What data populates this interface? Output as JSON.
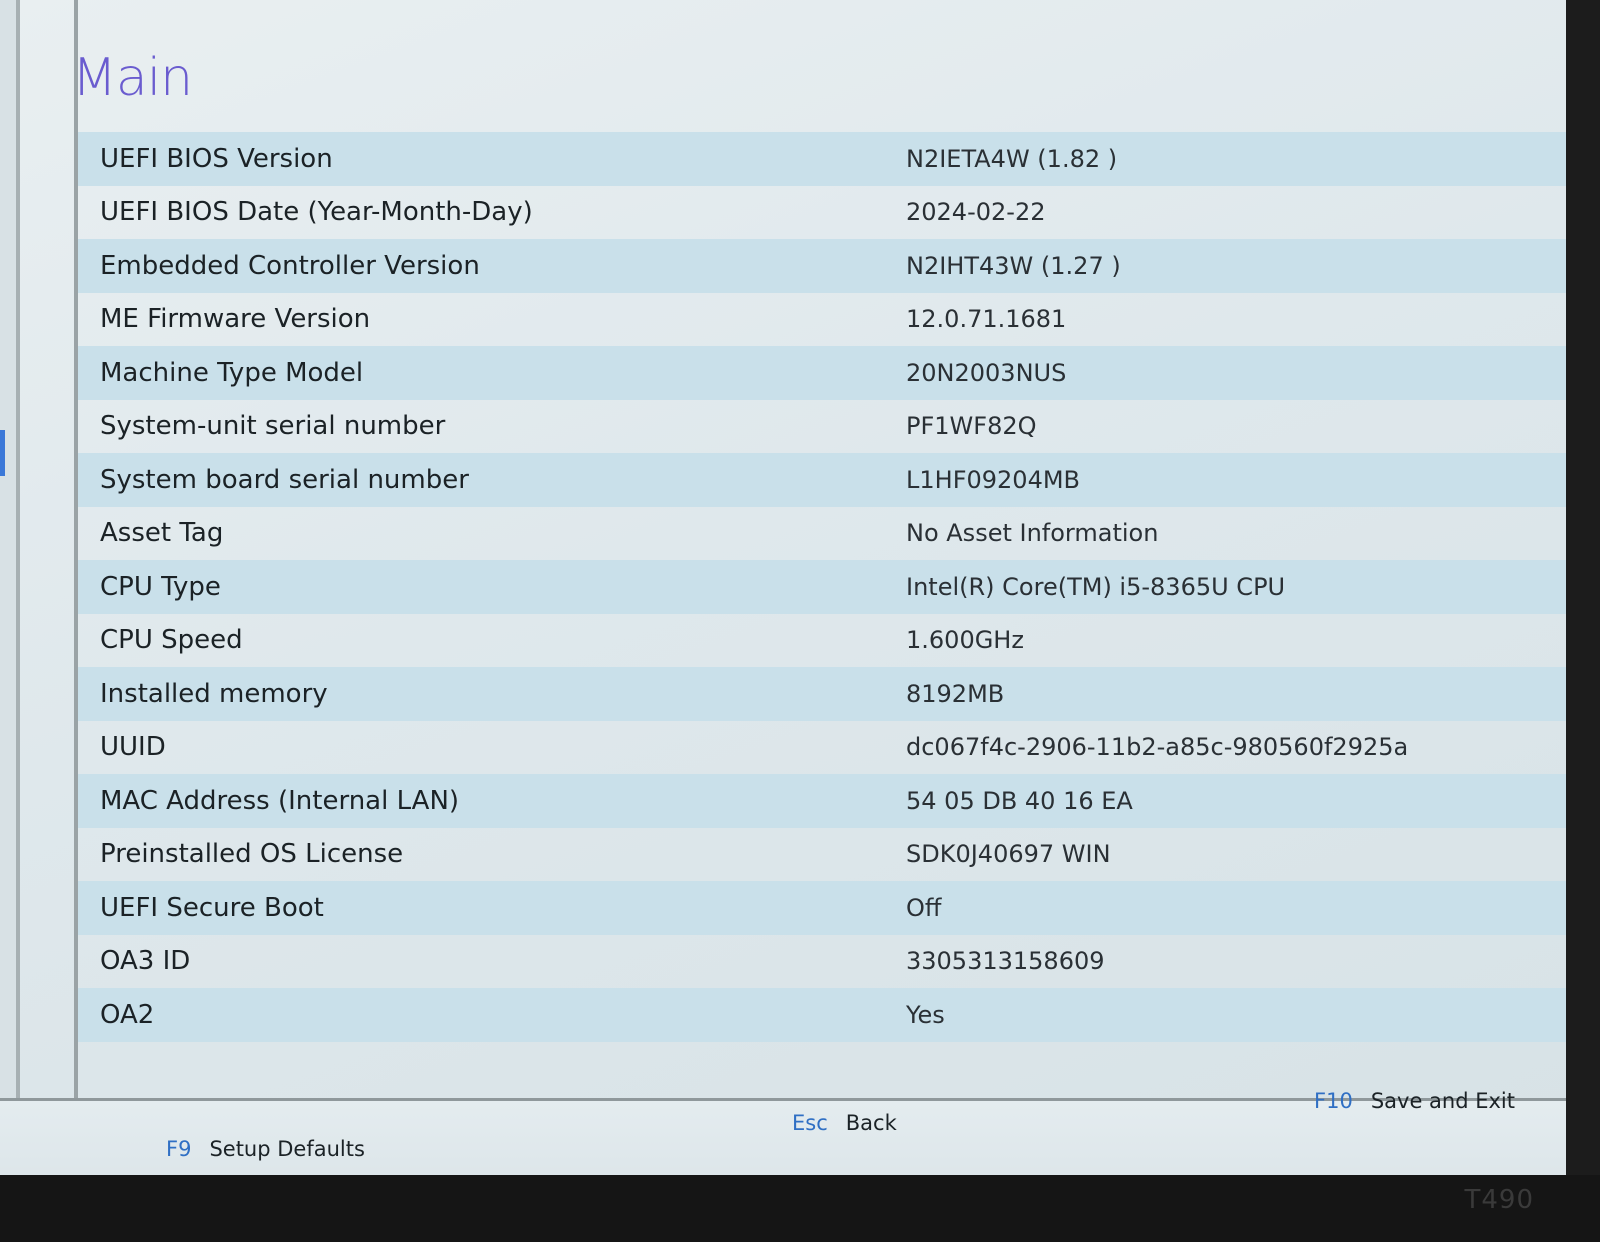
{
  "page": {
    "title": "Main"
  },
  "info_rows": [
    {
      "label": "UEFI BIOS Version",
      "value": "N2IETA4W (1.82 )"
    },
    {
      "label": "UEFI BIOS Date (Year-Month-Day)",
      "value": "2024-02-22"
    },
    {
      "label": "Embedded Controller Version",
      "value": "N2IHT43W (1.27 )"
    },
    {
      "label": "ME Firmware Version",
      "value": "12.0.71.1681"
    },
    {
      "label": "Machine Type Model",
      "value": "20N2003NUS"
    },
    {
      "label": "System-unit serial number",
      "value": "PF1WF82Q"
    },
    {
      "label": "System board serial number",
      "value": "L1HF09204MB"
    },
    {
      "label": "Asset Tag",
      "value": "No Asset Information"
    },
    {
      "label": "CPU Type",
      "value": "Intel(R) Core(TM) i5-8365U CPU"
    },
    {
      "label": "CPU Speed",
      "value": "1.600GHz"
    },
    {
      "label": "Installed memory",
      "value": "8192MB"
    },
    {
      "label": "UUID",
      "value": "dc067f4c-2906-11b2-a85c-980560f2925a"
    },
    {
      "label": "MAC Address (Internal LAN)",
      "value": "54 05 DB 40 16 EA"
    },
    {
      "label": "Preinstalled OS License",
      "value": "SDK0J40697 WIN"
    },
    {
      "label": "UEFI Secure Boot",
      "value": "Off"
    },
    {
      "label": "OA3 ID",
      "value": "3305313158609"
    },
    {
      "label": "OA2",
      "value": "Yes"
    }
  ],
  "footer": {
    "setup_defaults": {
      "key": "F9",
      "action": "Setup Defaults"
    },
    "back": {
      "key": "Esc",
      "action": "Back"
    },
    "save_exit": {
      "key": "F10",
      "action": "Save and Exit"
    }
  },
  "device": {
    "model": "T490"
  },
  "colors": {
    "title": "#6a5ccf",
    "row_shade": "#c9e0ea",
    "key_text": "#2f6fc4"
  }
}
